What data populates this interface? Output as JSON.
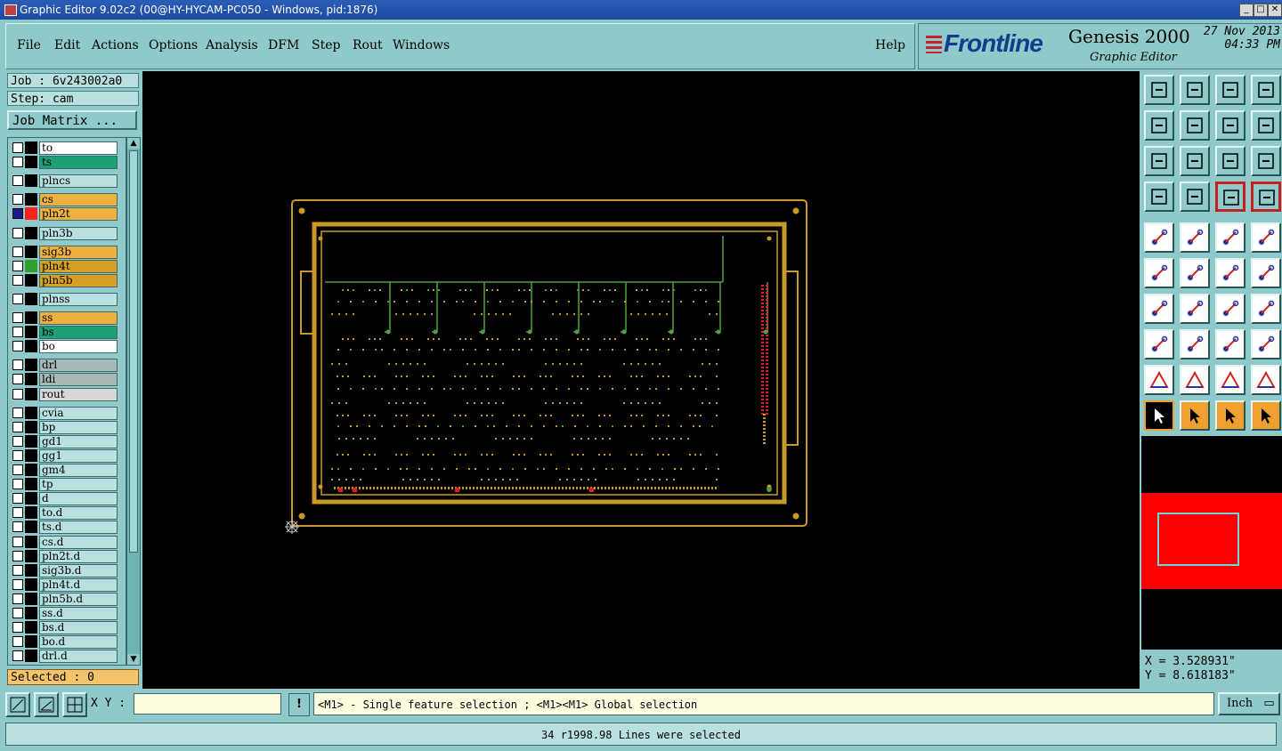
{
  "window": {
    "title": "Graphic Editor 9.02c2 (00@HY-HYCAM-PC050 - Windows, pid:1876)",
    "min": "_",
    "max": "□",
    "close": "✕"
  },
  "menu": {
    "file": "File",
    "edit": "Edit",
    "actions": "Actions",
    "options": "Options",
    "analysis": "Analysis",
    "dfm": "DFM",
    "step": "Step",
    "rout": "Rout",
    "windows": "Windows",
    "help": "Help"
  },
  "brand": {
    "logo": "Frontline",
    "product": "Genesis 2000",
    "subtitle": "Graphic Editor",
    "date_line1": "27 Nov 2013",
    "date_line2": "04:33 PM"
  },
  "job": {
    "job": "Job : 6v243002a0",
    "step": "Step: cam",
    "job_matrix": "Job Matrix ..."
  },
  "layers": [
    {
      "name": "to",
      "color": "#ffffff",
      "mark": ""
    },
    {
      "name": "ts",
      "color": "#1f9f74",
      "mark": ""
    },
    {
      "name": "plncs",
      "color": "#b8e0e0",
      "mark": ""
    },
    {
      "name": "cs",
      "color": "#f0b040",
      "mark": ""
    },
    {
      "name": "pln2t",
      "color": "#f0b040",
      "mark": "#ff2020",
      "active": true
    },
    {
      "name": "pln3b",
      "color": "#b8e0e0",
      "mark": ""
    },
    {
      "name": "sig3b",
      "color": "#f0b040",
      "mark": ""
    },
    {
      "name": "pln4t",
      "color": "#d8a020",
      "mark": "#30a030"
    },
    {
      "name": "pln5b",
      "color": "#d8a020",
      "mark": ""
    },
    {
      "name": "plnss",
      "color": "#b8e0e0",
      "mark": ""
    },
    {
      "name": "ss",
      "color": "#f0b040",
      "mark": ""
    },
    {
      "name": "bs",
      "color": "#1f9f74",
      "mark": ""
    },
    {
      "name": "bo",
      "color": "#ffffff",
      "mark": ""
    },
    {
      "name": "drl",
      "color": "#a8b8b8",
      "mark": ""
    },
    {
      "name": "ldi",
      "color": "#a8b8b8",
      "mark": ""
    },
    {
      "name": "rout",
      "color": "#d8d8d8",
      "mark": ""
    },
    {
      "name": "cvia",
      "color": "#b8e0e0",
      "mark": ""
    },
    {
      "name": "bp",
      "color": "#b8e0e0",
      "mark": ""
    },
    {
      "name": "gd1",
      "color": "#b8e0e0",
      "mark": ""
    },
    {
      "name": "gg1",
      "color": "#b8e0e0",
      "mark": ""
    },
    {
      "name": "gm4",
      "color": "#b8e0e0",
      "mark": ""
    },
    {
      "name": "tp",
      "color": "#b8e0e0",
      "mark": ""
    },
    {
      "name": "d",
      "color": "#b8e0e0",
      "mark": ""
    },
    {
      "name": "to.d",
      "color": "#b8e0e0",
      "mark": ""
    },
    {
      "name": "ts.d",
      "color": "#b8e0e0",
      "mark": ""
    },
    {
      "name": "cs.d",
      "color": "#b8e0e0",
      "mark": ""
    },
    {
      "name": "pln2t.d",
      "color": "#b8e0e0",
      "mark": ""
    },
    {
      "name": "sig3b.d",
      "color": "#b8e0e0",
      "mark": ""
    },
    {
      "name": "pln4t.d",
      "color": "#b8e0e0",
      "mark": ""
    },
    {
      "name": "pln5b.d",
      "color": "#b8e0e0",
      "mark": ""
    },
    {
      "name": "ss.d",
      "color": "#b8e0e0",
      "mark": ""
    },
    {
      "name": "bs.d",
      "color": "#b8e0e0",
      "mark": ""
    },
    {
      "name": "bo.d",
      "color": "#b8e0e0",
      "mark": ""
    },
    {
      "name": "drl.d",
      "color": "#b8e0e0",
      "mark": ""
    }
  ],
  "selected": "Selected : 0",
  "coords": {
    "x": "X = 3.528931\"",
    "y": "Y = 8.618183\""
  },
  "cmd": {
    "xy_label": "X Y :",
    "xy_value": "",
    "excl": "!",
    "hint": "<M1> - Single feature selection ; <M1><M1> Global selection",
    "unit": "Inch"
  },
  "status": "34 r1998.98 Lines were selected",
  "colors": {
    "panel": "#8fc9c9",
    "board": "#c89a28",
    "trace": "#4fa040",
    "pad": "#e02020"
  }
}
